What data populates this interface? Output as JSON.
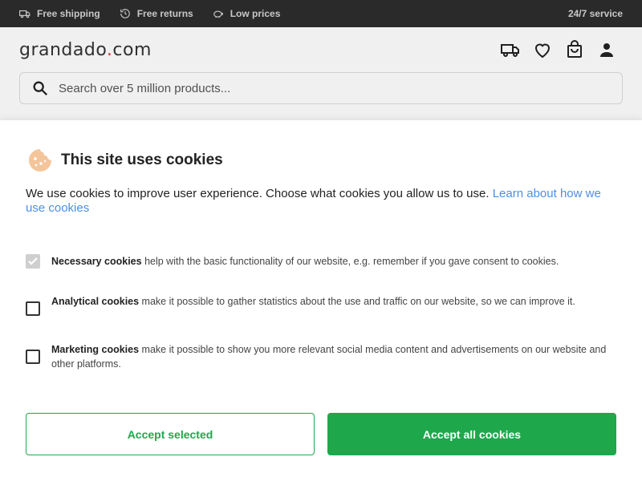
{
  "topbar": {
    "usps": [
      {
        "icon": "truck-icon",
        "label": "Free shipping"
      },
      {
        "icon": "return-icon",
        "label": "Free returns"
      },
      {
        "icon": "piggy-bank-icon",
        "label": "Low prices"
      }
    ],
    "service": "24/7 service"
  },
  "header": {
    "logo_main": "grandado",
    "logo_dot": ".",
    "logo_tld": "com",
    "search_placeholder": "Search over 5 million products..."
  },
  "cookies": {
    "title": "This site uses cookies",
    "intro": "We use cookies to improve user experience. Choose what cookies you allow us to use. ",
    "learn_more": "Learn about how we use cookies",
    "options": [
      {
        "name": "Necessary cookies",
        "text": " help with the basic functionality of our website, e.g. remember if you gave consent to cookies.",
        "checked": true,
        "disabled": true
      },
      {
        "name": "Analytical cookies",
        "text": " make it possible to gather statistics about the use and traffic on our website, so we can improve it.",
        "checked": false,
        "disabled": false
      },
      {
        "name": "Marketing cookies",
        "text": " make it possible to show you more relevant social media content and advertisements on our website and other platforms.",
        "checked": false,
        "disabled": false
      }
    ],
    "accept_selected": "Accept selected",
    "accept_all": "Accept all cookies"
  },
  "colors": {
    "accent_green": "#1ea84b",
    "link_blue": "#4a90e2",
    "topbar_bg": "#2a2a2a"
  }
}
